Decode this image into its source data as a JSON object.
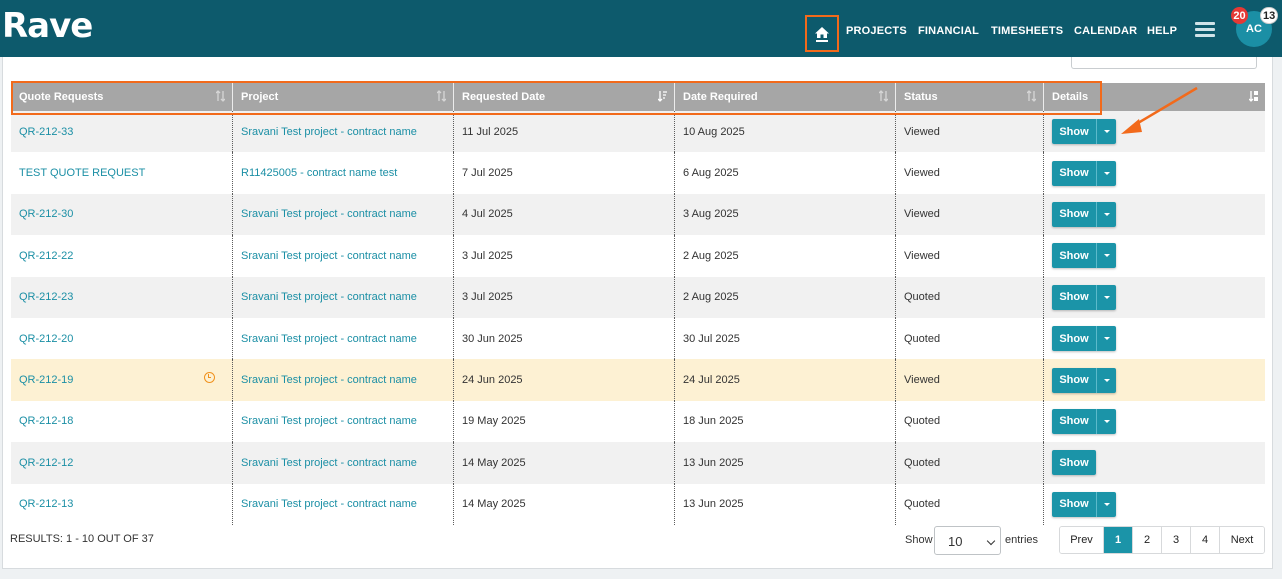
{
  "header": {
    "logo": "Rave",
    "nav": [
      "PROJECTS",
      "FINANCIAL",
      "TIMESHEETS",
      "CALENDAR",
      "HELP"
    ],
    "avatar_initials": "AC",
    "badge_red": "20",
    "badge_white": "13"
  },
  "table": {
    "columns": [
      "Quote Requests",
      "Project",
      "Requested Date",
      "Date Required",
      "Status",
      "Details"
    ],
    "show_label": "Show",
    "rows": [
      {
        "id": "QR-212-33",
        "project": "Sravani Test project - contract name",
        "requested": "11 Jul 2025",
        "required": "10 Aug 2025",
        "status": "Viewed"
      },
      {
        "id": "TEST QUOTE REQUEST",
        "project": "R11425005 - contract name test",
        "requested": "7 Jul 2025",
        "required": "6 Aug 2025",
        "status": "Viewed"
      },
      {
        "id": "QR-212-30",
        "project": "Sravani Test project - contract name",
        "requested": "4 Jul 2025",
        "required": "3 Aug 2025",
        "status": "Viewed"
      },
      {
        "id": "QR-212-22",
        "project": "Sravani Test project - contract name",
        "requested": "3 Jul 2025",
        "required": "2 Aug 2025",
        "status": "Viewed"
      },
      {
        "id": "QR-212-23",
        "project": "Sravani Test project - contract name",
        "requested": "3 Jul 2025",
        "required": "2 Aug 2025",
        "status": "Quoted"
      },
      {
        "id": "QR-212-20",
        "project": "Sravani Test project - contract name",
        "requested": "30 Jun 2025",
        "required": "30 Jul 2025",
        "status": "Quoted"
      },
      {
        "id": "QR-212-19",
        "project": "Sravani Test project - contract name",
        "requested": "24 Jun 2025",
        "required": "24 Jul 2025",
        "status": "Viewed"
      },
      {
        "id": "QR-212-18",
        "project": "Sravani Test project - contract name",
        "requested": "19 May 2025",
        "required": "18 Jun 2025",
        "status": "Quoted"
      },
      {
        "id": "QR-212-12",
        "project": "Sravani Test project - contract name",
        "requested": "14 May 2025",
        "required": "13 Jun 2025",
        "status": "Quoted"
      },
      {
        "id": "QR-212-13",
        "project": "Sravani Test project - contract name",
        "requested": "14 May 2025",
        "required": "13 Jun 2025",
        "status": "Quoted"
      }
    ]
  },
  "footer": {
    "results": "RESULTS: 1 - 10 OUT OF 37",
    "show": "Show",
    "entries_value": "10",
    "entries": "entries",
    "pager": [
      "Prev",
      "1",
      "2",
      "3",
      "4",
      "Next"
    ]
  },
  "colors": {
    "nav_bg": "#0d5a6c",
    "accent": "#1b94a8",
    "annotation": "#f26a1b",
    "highlight_row": "#fdf1d3"
  }
}
